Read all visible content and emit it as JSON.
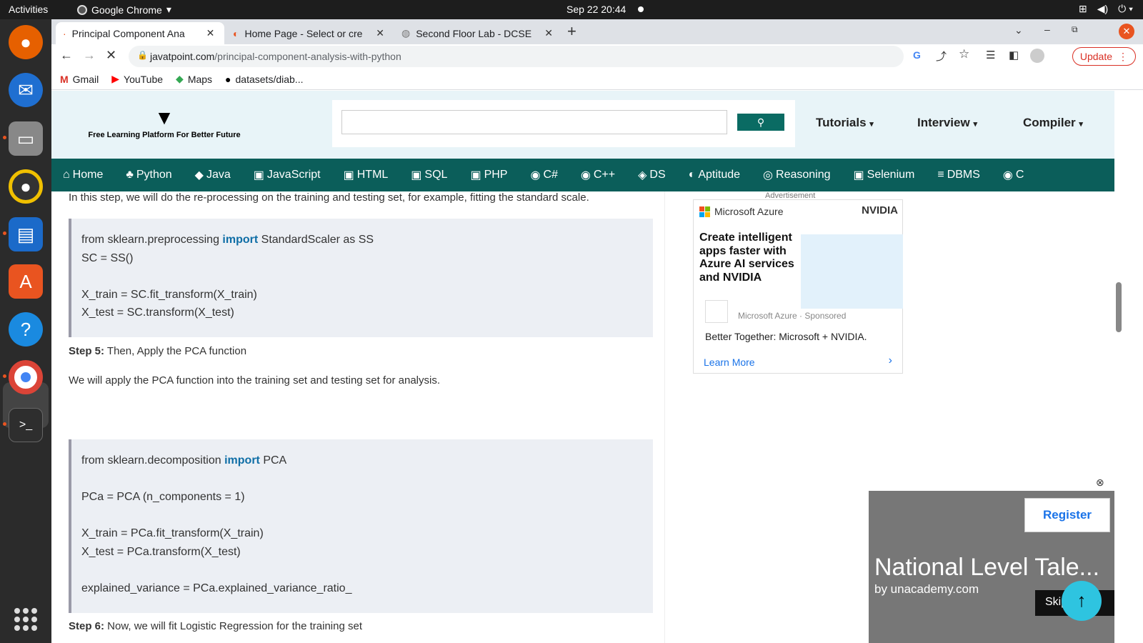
{
  "os": {
    "activities": "Activities",
    "app_name": "Google Chrome",
    "clock": "Sep 22  20:44"
  },
  "chrome": {
    "tabs": [
      {
        "title": "Principal Component Ana"
      },
      {
        "title": "Home Page - Select or cre"
      },
      {
        "title": "Second Floor Lab - DCSE"
      }
    ],
    "url_host": "javatpoint.com",
    "url_path": "/principal-component-analysis-with-python",
    "update_label": "Update",
    "bookmarks": [
      "Gmail",
      "YouTube",
      "Maps",
      "datasets/diab..."
    ]
  },
  "site": {
    "tagline": "Free Learning Platform For Better Future",
    "search_placeholder": "",
    "header_menus": [
      "Tutorials",
      "Interview",
      "Compiler"
    ],
    "nav": [
      "Home",
      "Python",
      "Java",
      "JavaScript",
      "HTML",
      "SQL",
      "PHP",
      "C#",
      "C++",
      "DS",
      "Aptitude",
      "Reasoning",
      "Selenium",
      "DBMS",
      "C"
    ]
  },
  "article": {
    "intro": "In this step, we will do the re-processing on the training and testing set, for example, fitting the standard scale.",
    "code1": {
      "l1_pre": "from sklearn.preprocessing ",
      "l1_kw": "import",
      "l1_post": " StandardScaler as SS",
      "l2": "SC = SS()",
      "l3": "X_train = SC.fit_transform(X_train)",
      "l4": "X_test = SC.transform(X_test)"
    },
    "step5_label": "Step 5:",
    "step5_text": " Then, Apply the PCA function",
    "step5_desc": "We will apply the PCA function into the training set and testing set for analysis.",
    "code2": {
      "l1_pre": "from sklearn.decomposition ",
      "l1_kw": "import",
      "l1_post": " PCA",
      "l2": "PCa = PCA (n_components = 1)",
      "l3": "X_train = PCa.fit_transform(X_train)",
      "l4": "X_test = PCa.transform(X_test)",
      "l5": "explained_variance = PCa.explained_variance_ratio_"
    },
    "step6_label": "Step 6:",
    "step6_text": " Now, we will fit Logistic Regression for the training set"
  },
  "ad": {
    "label": "Advertisement",
    "brand": "Microsoft Azure",
    "partner": "NVIDIA",
    "headline": "Create intelligent apps faster with Azure AI services and NVIDIA",
    "sponsor": "Microsoft Azure · Sponsored",
    "body": "Better Together: Microsoft + NVIDIA.",
    "cta": "Learn More"
  },
  "promo": {
    "register": "Register",
    "title": "National Level Tale...",
    "by": "by unacademy.com",
    "skip": "Skip Ad"
  }
}
